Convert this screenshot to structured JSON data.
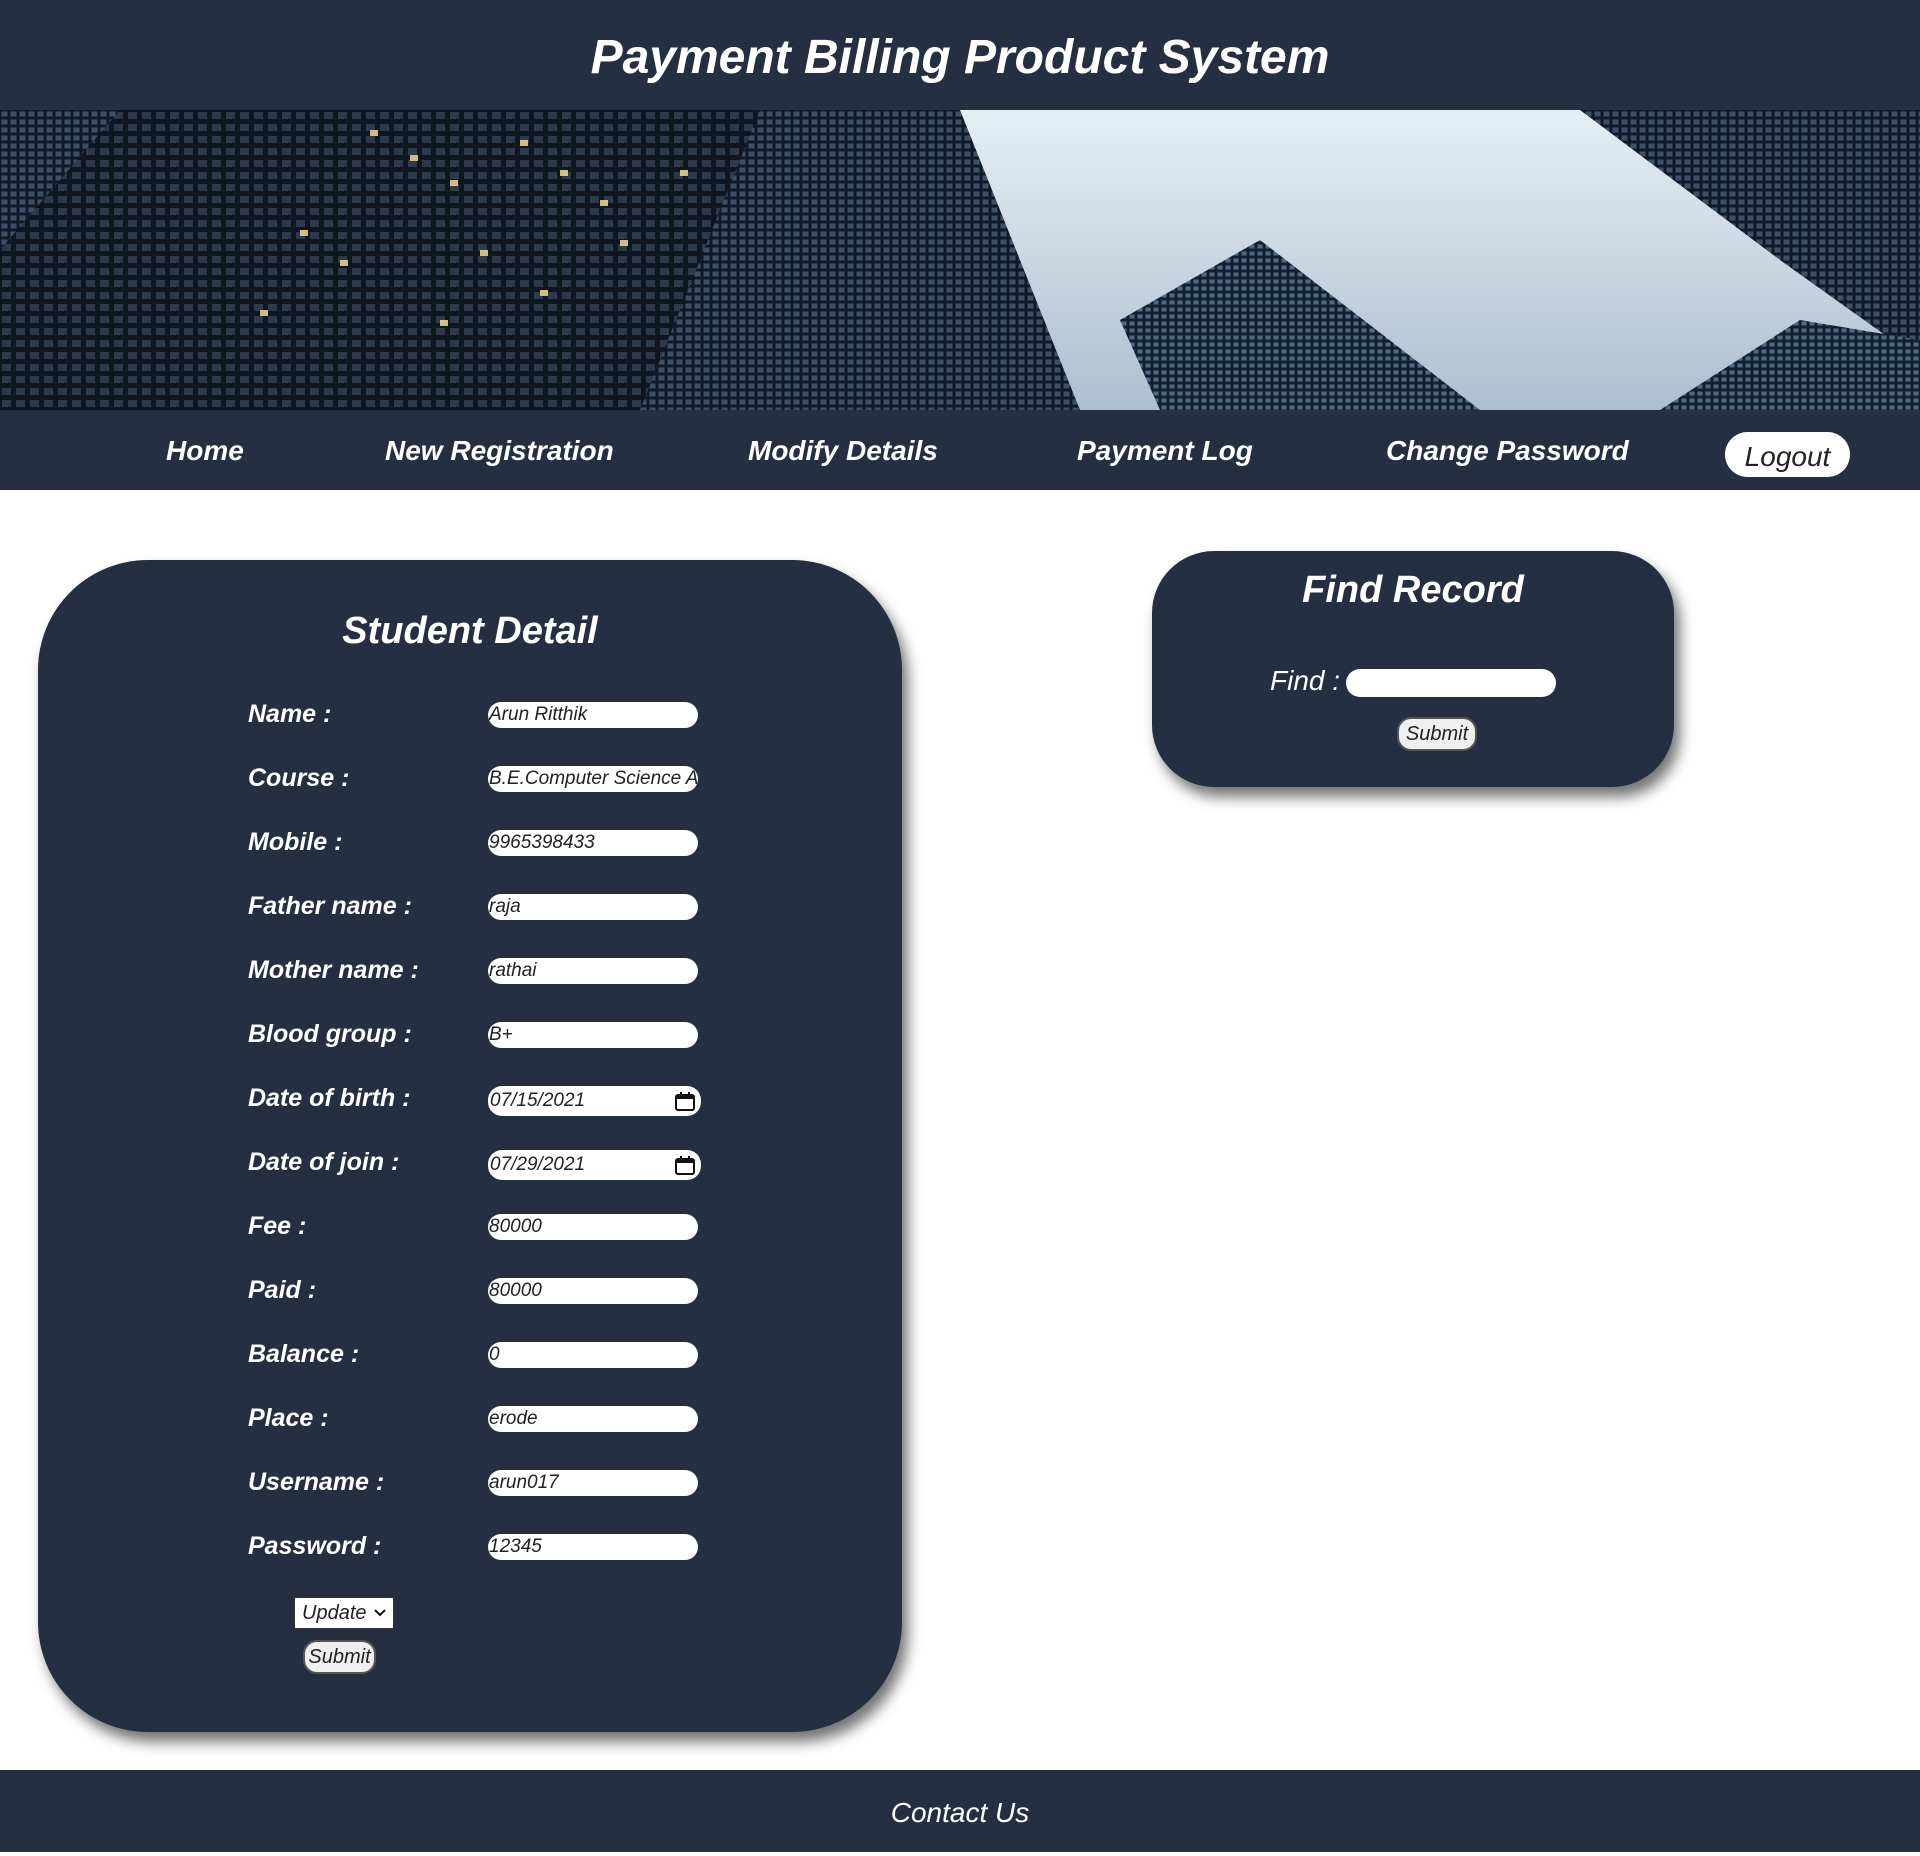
{
  "header": {
    "title": "Payment Billing Product System"
  },
  "banner": {
    "image": "city-skyscrapers-banner"
  },
  "nav": {
    "items": [
      {
        "label": "Home"
      },
      {
        "label": "New Registration"
      },
      {
        "label": "Modify Details"
      },
      {
        "label": "Payment Log"
      },
      {
        "label": "Change Password"
      }
    ],
    "logout_label": "Logout"
  },
  "student_detail": {
    "title": "Student Detail",
    "fields": [
      {
        "label": "Name :",
        "value": "Arun Ritthik"
      },
      {
        "label": "Course :",
        "value": "B.E.Computer Science Ar"
      },
      {
        "label": "Mobile :",
        "value": "9965398433"
      },
      {
        "label": "Father name :",
        "value": "raja"
      },
      {
        "label": "Mother name :",
        "value": "rathai"
      },
      {
        "label": "Blood group :",
        "value": "B+"
      },
      {
        "label": "Date of birth :",
        "value": "07/15/2021"
      },
      {
        "label": "Date of join :",
        "value": "07/29/2021"
      },
      {
        "label": "Fee :",
        "value": "80000"
      },
      {
        "label": "Paid :",
        "value": "80000"
      },
      {
        "label": "Balance :",
        "value": "0"
      },
      {
        "label": "Place :",
        "value": "erode"
      },
      {
        "label": "Username :",
        "value": "arun017"
      },
      {
        "label": "Password :",
        "value": "12345"
      }
    ],
    "action_select": "Update",
    "submit_label": "Submit"
  },
  "find_record": {
    "title": "Find Record",
    "find_label": "Find :",
    "find_value": "",
    "submit_label": "Submit"
  },
  "footer": {
    "label": "Contact Us"
  },
  "colors": {
    "panel": "#243042",
    "background": "#ffffff"
  }
}
